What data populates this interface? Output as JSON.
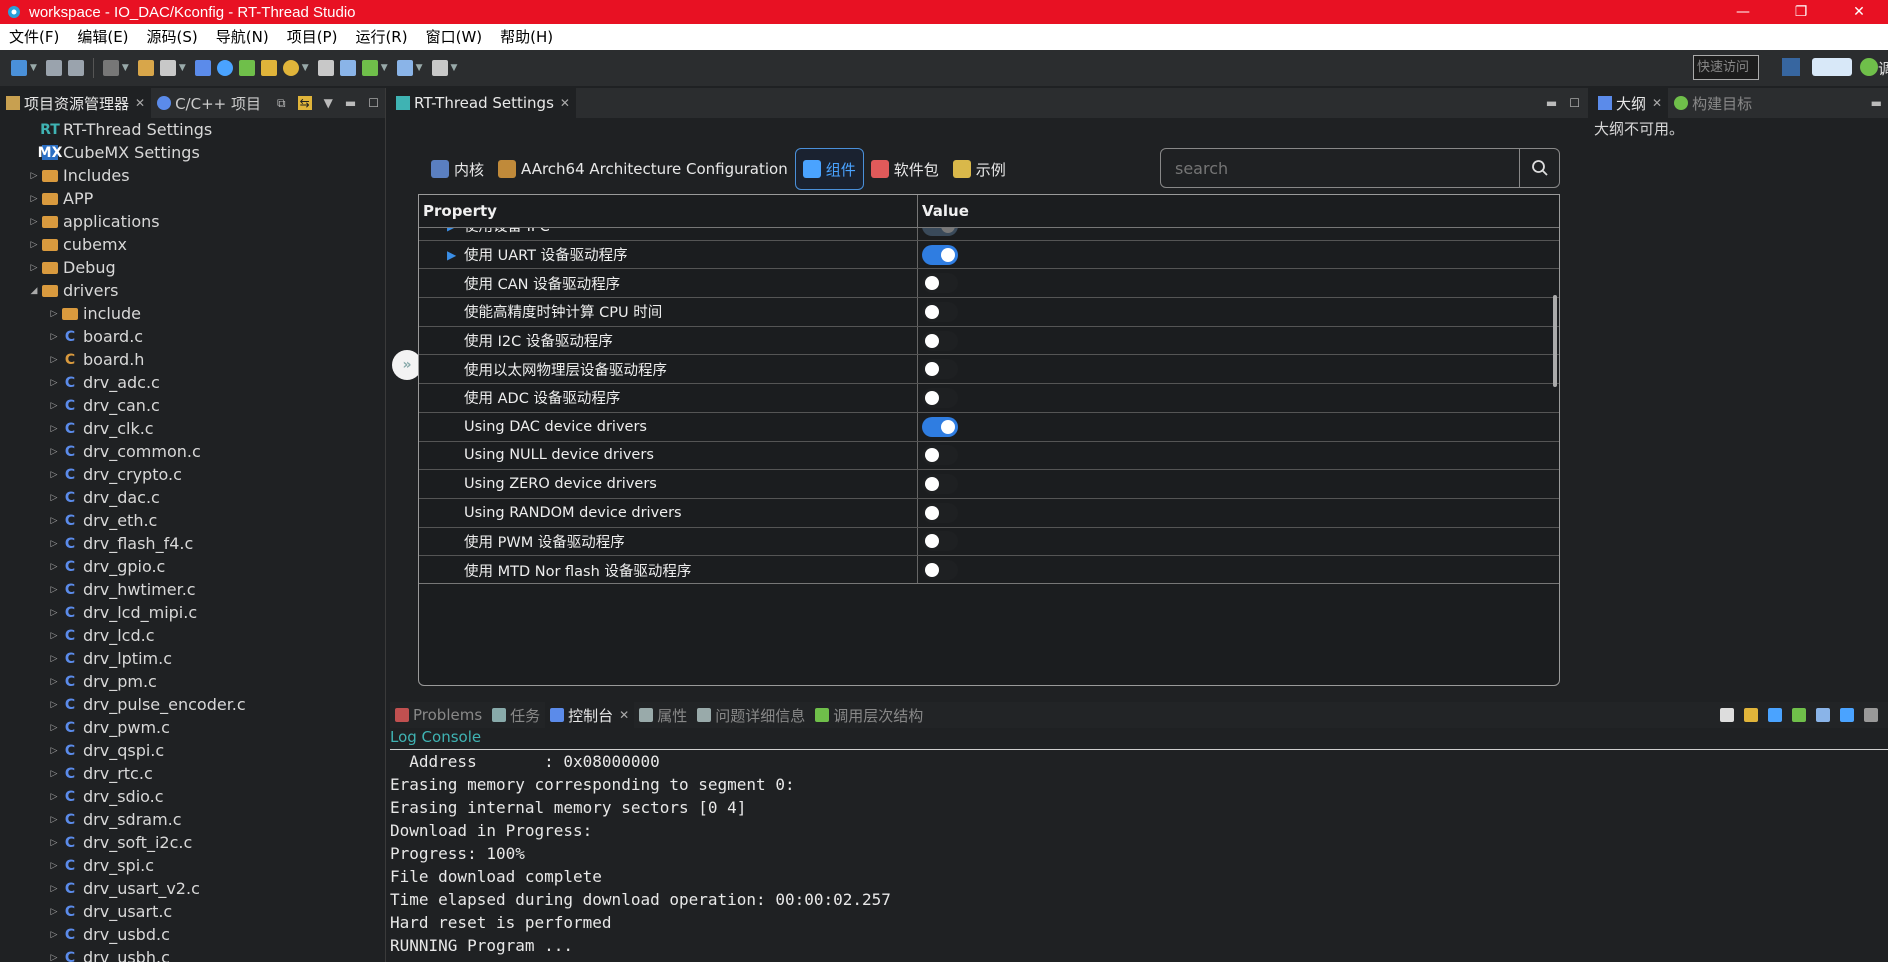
{
  "window": {
    "title": "workspace - IO_DAC/Kconfig - RT-Thread Studio",
    "minimize": "—",
    "restore": "❐",
    "close": "✕"
  },
  "menubar": [
    "文件(F)",
    "编辑(E)",
    "源码(S)",
    "导航(N)",
    "项目(P)",
    "运行(R)",
    "窗口(W)",
    "帮助(H)"
  ],
  "toolbar": {
    "quick_access_placeholder": "快速访问",
    "right_label": "调"
  },
  "left_panel": {
    "tabs": [
      {
        "label": "项目资源管理器",
        "active": true
      },
      {
        "label": "C/C++ 项目",
        "active": false
      }
    ],
    "tree": [
      {
        "label": "RT-Thread Settings",
        "level": 1,
        "icon": "rt-icon",
        "arrow": ""
      },
      {
        "label": "CubeMX Settings",
        "level": 1,
        "icon": "mx-icon",
        "arrow": ""
      },
      {
        "label": "Includes",
        "level": 1,
        "icon": "folder",
        "arrow": "▷"
      },
      {
        "label": "APP",
        "level": 1,
        "icon": "folder",
        "arrow": "▷"
      },
      {
        "label": "applications",
        "level": 1,
        "icon": "folder",
        "arrow": "▷"
      },
      {
        "label": "cubemx",
        "level": 1,
        "icon": "folder",
        "arrow": "▷"
      },
      {
        "label": "Debug",
        "level": 1,
        "icon": "folder",
        "arrow": "▷"
      },
      {
        "label": "drivers",
        "level": 1,
        "icon": "folder",
        "arrow": "◢"
      },
      {
        "label": "include",
        "level": 2,
        "icon": "folder",
        "arrow": "▷"
      },
      {
        "label": "board.c",
        "level": 2,
        "icon": "c",
        "arrow": "▷"
      },
      {
        "label": "board.h",
        "level": 2,
        "icon": "h",
        "arrow": "▷"
      },
      {
        "label": "drv_adc.c",
        "level": 2,
        "icon": "c",
        "arrow": "▷"
      },
      {
        "label": "drv_can.c",
        "level": 2,
        "icon": "c",
        "arrow": "▷"
      },
      {
        "label": "drv_clk.c",
        "level": 2,
        "icon": "c",
        "arrow": "▷"
      },
      {
        "label": "drv_common.c",
        "level": 2,
        "icon": "c",
        "arrow": "▷"
      },
      {
        "label": "drv_crypto.c",
        "level": 2,
        "icon": "c",
        "arrow": "▷"
      },
      {
        "label": "drv_dac.c",
        "level": 2,
        "icon": "c",
        "arrow": "▷"
      },
      {
        "label": "drv_eth.c",
        "level": 2,
        "icon": "c",
        "arrow": "▷"
      },
      {
        "label": "drv_flash_f4.c",
        "level": 2,
        "icon": "c",
        "arrow": "▷"
      },
      {
        "label": "drv_gpio.c",
        "level": 2,
        "icon": "c",
        "arrow": "▷"
      },
      {
        "label": "drv_hwtimer.c",
        "level": 2,
        "icon": "c",
        "arrow": "▷"
      },
      {
        "label": "drv_lcd_mipi.c",
        "level": 2,
        "icon": "c",
        "arrow": "▷"
      },
      {
        "label": "drv_lcd.c",
        "level": 2,
        "icon": "c",
        "arrow": "▷"
      },
      {
        "label": "drv_lptim.c",
        "level": 2,
        "icon": "c",
        "arrow": "▷"
      },
      {
        "label": "drv_pm.c",
        "level": 2,
        "icon": "c",
        "arrow": "▷"
      },
      {
        "label": "drv_pulse_encoder.c",
        "level": 2,
        "icon": "c",
        "arrow": "▷"
      },
      {
        "label": "drv_pwm.c",
        "level": 2,
        "icon": "c",
        "arrow": "▷"
      },
      {
        "label": "drv_qspi.c",
        "level": 2,
        "icon": "c",
        "arrow": "▷"
      },
      {
        "label": "drv_rtc.c",
        "level": 2,
        "icon": "c",
        "arrow": "▷"
      },
      {
        "label": "drv_sdio.c",
        "level": 2,
        "icon": "c",
        "arrow": "▷"
      },
      {
        "label": "drv_sdram.c",
        "level": 2,
        "icon": "c",
        "arrow": "▷"
      },
      {
        "label": "drv_soft_i2c.c",
        "level": 2,
        "icon": "c",
        "arrow": "▷"
      },
      {
        "label": "drv_spi.c",
        "level": 2,
        "icon": "c",
        "arrow": "▷"
      },
      {
        "label": "drv_usart_v2.c",
        "level": 2,
        "icon": "c",
        "arrow": "▷"
      },
      {
        "label": "drv_usart.c",
        "level": 2,
        "icon": "c",
        "arrow": "▷"
      },
      {
        "label": "drv_usbd.c",
        "level": 2,
        "icon": "c",
        "arrow": "▷"
      },
      {
        "label": "drv_usbh.c",
        "level": 2,
        "icon": "c",
        "arrow": "▷"
      }
    ]
  },
  "editor": {
    "tab_label": "RT-Thread Settings",
    "settings_tabs": [
      {
        "label": "内核",
        "active": false,
        "icon_color": "#5a7fc0"
      },
      {
        "label": "AArch64 Architecture Configuration",
        "active": false,
        "icon_color": "#c08a3a"
      },
      {
        "label": "组件",
        "active": true,
        "icon_color": "#4aa3ff"
      },
      {
        "label": "软件包",
        "active": false,
        "icon_color": "#e05a5a"
      },
      {
        "label": "示例",
        "active": false,
        "icon_color": "#d9b84a"
      }
    ],
    "search_placeholder": "search",
    "table": {
      "col_property": "Property",
      "col_value": "Value",
      "rows": [
        {
          "name": "使用设备 IPC",
          "expand": true,
          "on": true
        },
        {
          "name": "使用 UART 设备驱动程序",
          "expand": true,
          "on": true
        },
        {
          "name": "使用 CAN 设备驱动程序",
          "expand": false,
          "on": false
        },
        {
          "name": "使能高精度时钟计算 CPU 时间",
          "expand": false,
          "on": false
        },
        {
          "name": "使用 I2C 设备驱动程序",
          "expand": false,
          "on": false
        },
        {
          "name": "使用以太网物理层设备驱动程序",
          "expand": false,
          "on": false
        },
        {
          "name": "使用 ADC 设备驱动程序",
          "expand": false,
          "on": false
        },
        {
          "name": "Using DAC device drivers",
          "expand": false,
          "on": true
        },
        {
          "name": "Using NULL device drivers",
          "expand": false,
          "on": false
        },
        {
          "name": "Using ZERO device drivers",
          "expand": false,
          "on": false
        },
        {
          "name": "Using RANDOM device drivers",
          "expand": false,
          "on": false
        },
        {
          "name": "使用 PWM 设备驱动程序",
          "expand": false,
          "on": false
        },
        {
          "name": "使用 MTD Nor flash 设备驱动程序",
          "expand": false,
          "on": false
        }
      ]
    }
  },
  "outline": {
    "tabs": [
      {
        "label": "大纲",
        "active": true
      },
      {
        "label": "构建目标",
        "active": false
      }
    ],
    "message": "大纲不可用。"
  },
  "console": {
    "tabs": [
      {
        "label": "Problems",
        "active": false
      },
      {
        "label": "任务",
        "active": false
      },
      {
        "label": "控制台",
        "active": true
      },
      {
        "label": "属性",
        "active": false
      },
      {
        "label": "问题详细信息",
        "active": false
      },
      {
        "label": "调用层次结构",
        "active": false
      }
    ],
    "title": "Log Console",
    "lines": [
      "  Address       : 0x08000000",
      "Erasing memory corresponding to segment 0:",
      "Erasing internal memory sectors [0 4]",
      "Download in Progress:",
      "Progress: 100%",
      "File download complete",
      "Time elapsed during download operation: 00:00:02.257",
      "Hard reset is performed",
      "RUNNING Program ...",
      "  ..."
    ]
  },
  "colors": {
    "titlebar": "#e81123",
    "accent": "#2f7de1",
    "background": "#1f2123"
  }
}
